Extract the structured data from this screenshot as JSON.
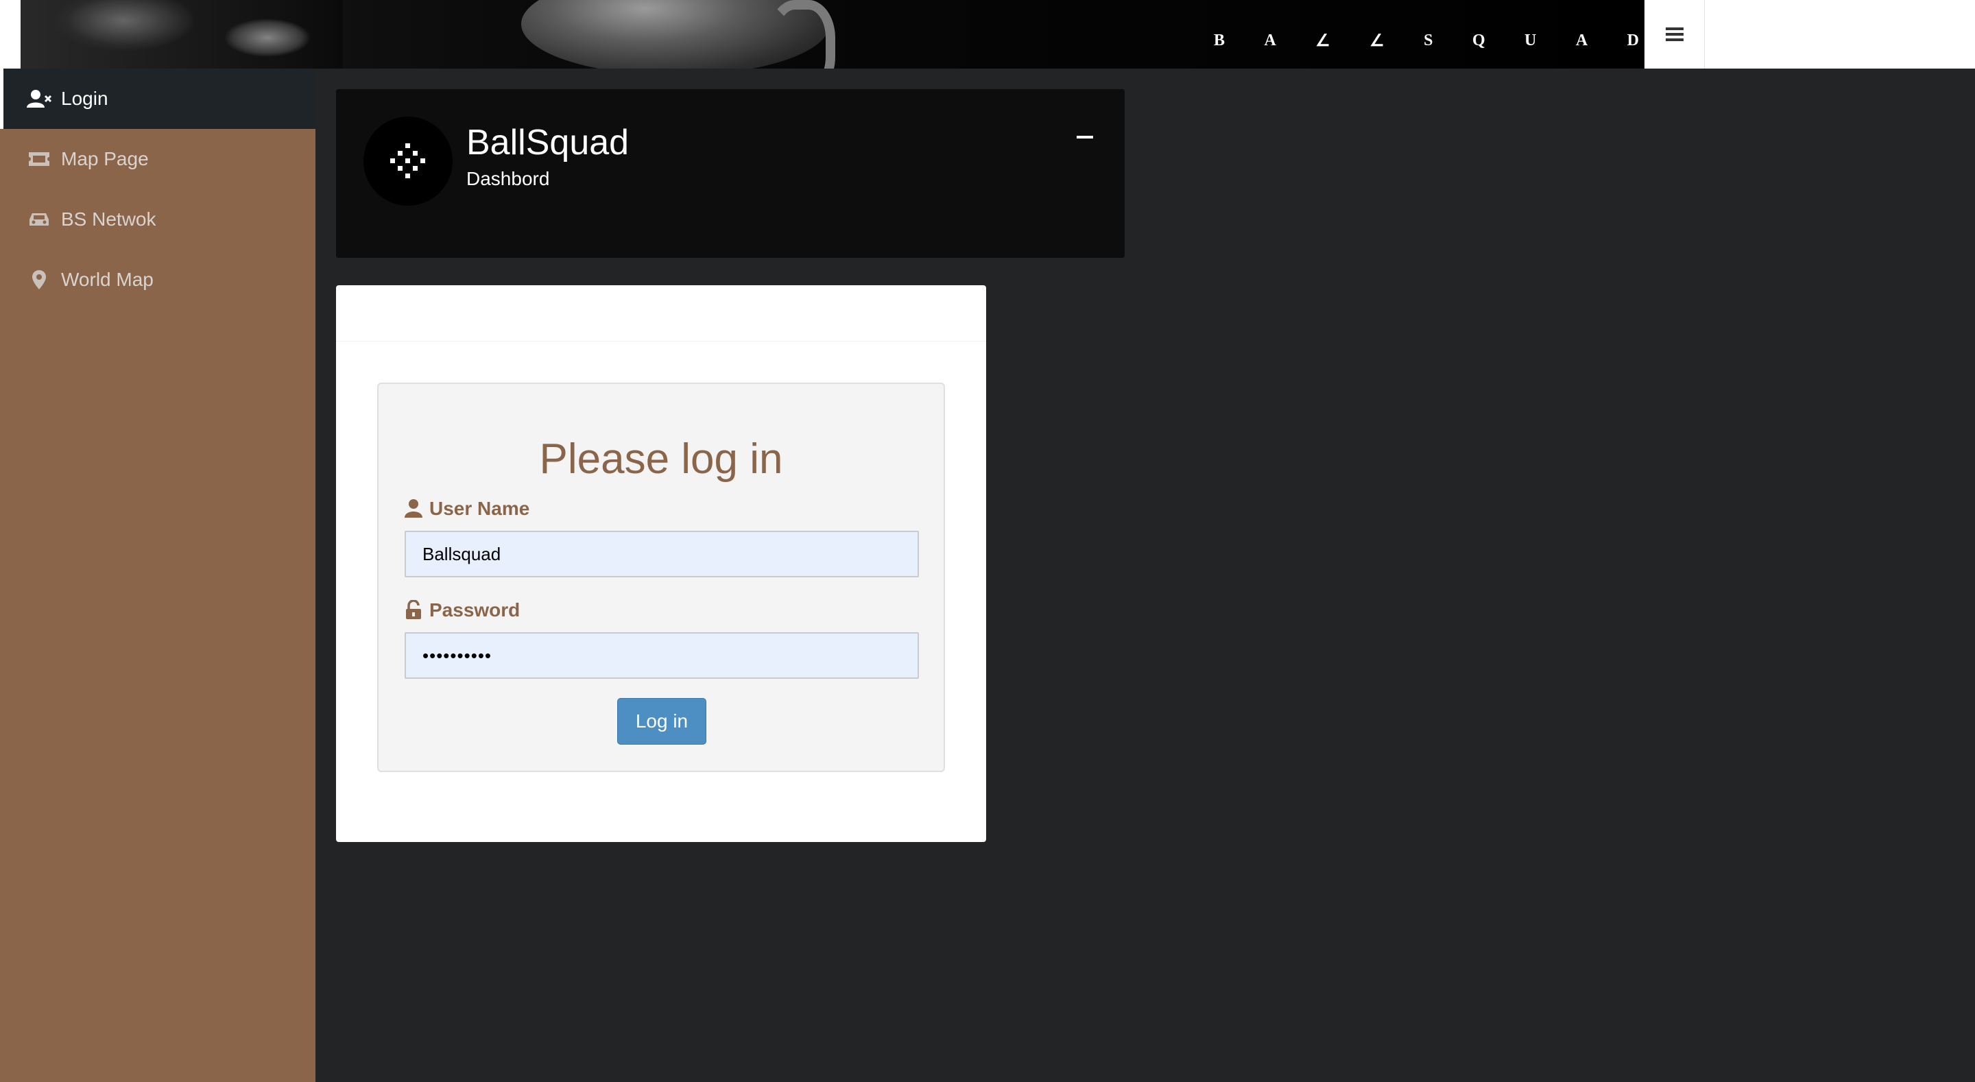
{
  "header": {
    "banner_letters": [
      "B",
      "A",
      "∠",
      "∠",
      "S",
      "Q",
      "U",
      "A",
      "D"
    ],
    "menu_icon": "hamburger-icon"
  },
  "sidebar": {
    "items": [
      {
        "label": "Login",
        "icon": "user-x-icon",
        "active": true
      },
      {
        "label": "Map Page",
        "icon": "ticket-icon",
        "active": false
      },
      {
        "label": "BS Netwok",
        "icon": "car-icon",
        "active": false
      },
      {
        "label": "World Map",
        "icon": "map-marker-icon",
        "active": false
      }
    ]
  },
  "profile": {
    "title": "BallSquad",
    "subtitle": "Dashbord",
    "collapse_symbol": "−"
  },
  "login": {
    "title": "Please log in",
    "username_label": "User Name",
    "username_value": "Ballsquad",
    "password_label": "Password",
    "password_value": "••••••••••",
    "button_label": "Log in"
  },
  "colors": {
    "sidebar_bg": "#8a6549",
    "page_bg": "#222426",
    "accent_brown": "#8a6549",
    "button_blue": "#4d8ec3",
    "input_bg": "#e8f0fe"
  }
}
